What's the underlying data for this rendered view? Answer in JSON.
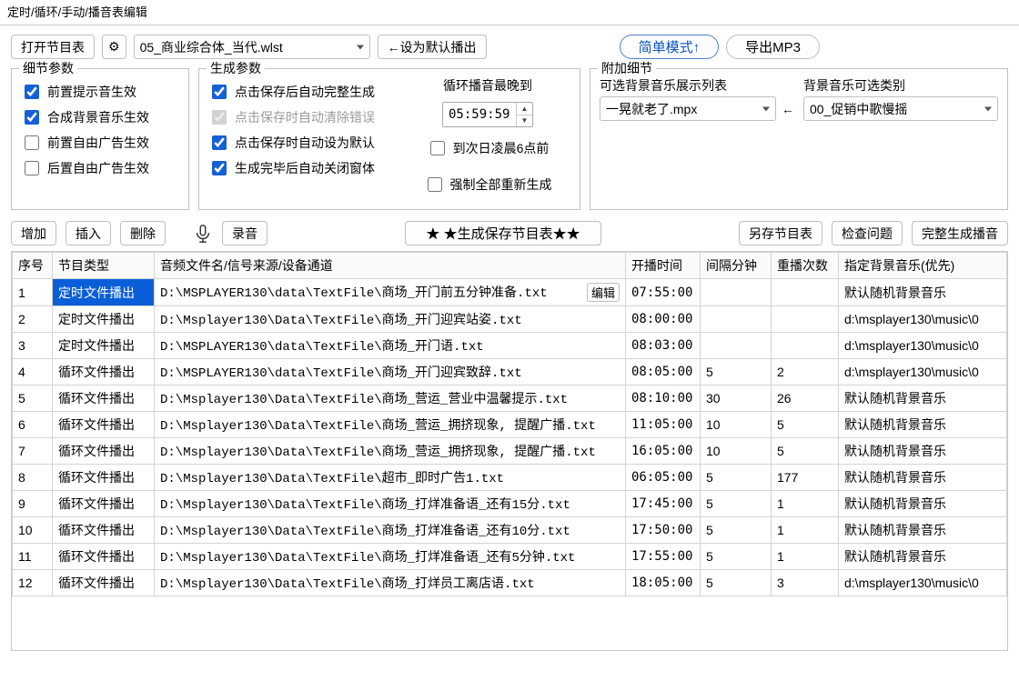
{
  "window_title": "定时/循环/手动/播音表编辑",
  "toolbar": {
    "open_list": "打开节目表",
    "gear": "⚙",
    "playlist_file": "05_商业综合体_当代.wlst",
    "set_default": "←设为默认播出",
    "simple_mode": "简单模式↑",
    "export_mp3": "导出MP3"
  },
  "detail_params": {
    "legend": "细节参数",
    "pre_hint_effect": "前置提示音生效",
    "synth_bg_effect": "合成背景音乐生效",
    "pre_free_ad_effect": "前置自由广告生效",
    "post_free_ad_effect": "后置自由广告生效"
  },
  "gen_params": {
    "legend": "生成参数",
    "auto_full_gen": "点击保存后自动完整生成",
    "auto_clear_err": "点击保存时自动清除错误",
    "auto_set_default": "点击保存时自动设为默认",
    "auto_close": "生成完毕后自动关闭窗体",
    "loop_latest_label": "循环播音最晚到",
    "latest_time": "05:59:59",
    "to_next_6am": "到次日凌晨6点前",
    "force_regen": "强制全部重新生成"
  },
  "extra": {
    "legend": "附加细节",
    "opt_bg_list_label": "可选背景音乐展示列表",
    "opt_bg_list_value": "一晃就老了.mpx",
    "arrow": "←",
    "bg_class_label": "背景音乐可选类别",
    "bg_class_value": "00_促销中歌慢摇"
  },
  "mid": {
    "add": "增加",
    "insert": "插入",
    "delete": "删除",
    "record": "录音",
    "star_save": "★ ★生成保存节目表★★",
    "save_as": "另存节目表",
    "check": "检查问题",
    "full_gen": "完整生成播音"
  },
  "headers": {
    "idx": "序号",
    "type": "节目类型",
    "file": "音频文件名/信号来源/设备通道",
    "time": "开播时间",
    "gap": "间隔分钟",
    "rep": "重播次数",
    "bg": "指定背景音乐(优先)"
  },
  "edit_btn": "编辑",
  "rows": [
    {
      "idx": "1",
      "type": "定时文件播出",
      "file": "D:\\MSPLAYER130\\data\\TextFile\\商场_开门前五分钟准备.txt",
      "time": "07:55:00",
      "gap": "",
      "rep": "",
      "bg": "默认随机背景音乐",
      "sel": true
    },
    {
      "idx": "2",
      "type": "定时文件播出",
      "file": "D:\\Msplayer130\\Data\\TextFile\\商场_开门迎宾站姿.txt",
      "time": "08:00:00",
      "gap": "",
      "rep": "",
      "bg": "d:\\msplayer130\\music\\0"
    },
    {
      "idx": "3",
      "type": "定时文件播出",
      "file": "D:\\MSPLAYER130\\data\\TextFile\\商场_开门语.txt",
      "time": "08:03:00",
      "gap": "",
      "rep": "",
      "bg": "d:\\msplayer130\\music\\0"
    },
    {
      "idx": "4",
      "type": "循环文件播出",
      "file": "D:\\MSPLAYER130\\data\\TextFile\\商场_开门迎宾致辞.txt",
      "time": "08:05:00",
      "gap": "5",
      "rep": "2",
      "bg": "d:\\msplayer130\\music\\0"
    },
    {
      "idx": "5",
      "type": "循环文件播出",
      "file": "D:\\Msplayer130\\Data\\TextFile\\商场_营运_营业中温馨提示.txt",
      "time": "08:10:00",
      "gap": "30",
      "rep": "26",
      "bg": "默认随机背景音乐"
    },
    {
      "idx": "6",
      "type": "循环文件播出",
      "file": "D:\\Msplayer130\\Data\\TextFile\\商场_营运_拥挤现象, 提醒广播.txt",
      "time": "11:05:00",
      "gap": "10",
      "rep": "5",
      "bg": "默认随机背景音乐"
    },
    {
      "idx": "7",
      "type": "循环文件播出",
      "file": "D:\\Msplayer130\\Data\\TextFile\\商场_营运_拥挤现象, 提醒广播.txt",
      "time": "16:05:00",
      "gap": "10",
      "rep": "5",
      "bg": "默认随机背景音乐"
    },
    {
      "idx": "8",
      "type": "循环文件播出",
      "file": "D:\\Msplayer130\\Data\\TextFile\\超市_即时广告1.txt",
      "time": "06:05:00",
      "gap": "5",
      "rep": "177",
      "bg": "默认随机背景音乐"
    },
    {
      "idx": "9",
      "type": "循环文件播出",
      "file": "D:\\Msplayer130\\Data\\TextFile\\商场_打烊准备语_还有15分.txt",
      "time": "17:45:00",
      "gap": "5",
      "rep": "1",
      "bg": "默认随机背景音乐"
    },
    {
      "idx": "10",
      "type": "循环文件播出",
      "file": "D:\\Msplayer130\\Data\\TextFile\\商场_打烊准备语_还有10分.txt",
      "time": "17:50:00",
      "gap": "5",
      "rep": "1",
      "bg": "默认随机背景音乐"
    },
    {
      "idx": "11",
      "type": "循环文件播出",
      "file": "D:\\Msplayer130\\Data\\TextFile\\商场_打烊准备语_还有5分钟.txt",
      "time": "17:55:00",
      "gap": "5",
      "rep": "1",
      "bg": "默认随机背景音乐"
    },
    {
      "idx": "12",
      "type": "循环文件播出",
      "file": "D:\\Msplayer130\\Data\\TextFile\\商场_打烊员工离店语.txt",
      "time": "18:05:00",
      "gap": "5",
      "rep": "3",
      "bg": "d:\\msplayer130\\music\\0"
    }
  ]
}
